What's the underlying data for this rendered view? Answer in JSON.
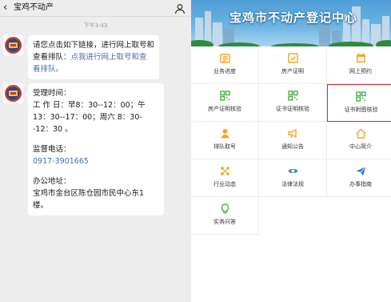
{
  "chat": {
    "title": "宝鸡不动产",
    "back_icon": "chevron-left-icon",
    "profile_icon": "person-icon",
    "timestamp": "下午3:43",
    "messages": [
      {
        "line1": "请您点击如下链接，进行网上取号和查看排队：",
        "link": "点我进行网上取号和查看排队。"
      },
      {
        "hours_label": "受理时间：",
        "hours_text": "工 作 日：早8：30--12：00；午13：30--17：00；周六 8：30--12：30 。",
        "phone_label": "监督电话：",
        "phone": "0917-3901665",
        "address_label": "办公地址：",
        "address": "宝鸡市金台区陈仓园市民中心东1楼。"
      }
    ]
  },
  "portal": {
    "banner_title": "宝鸡市不动产登记中心",
    "menu": [
      {
        "label": "业务进度",
        "icon": "progress-icon",
        "color": "#f5a623"
      },
      {
        "label": "房产证明",
        "icon": "certificate-icon",
        "color": "#f5a623"
      },
      {
        "label": "网上预约",
        "icon": "calendar-icon",
        "color": "#f5a623"
      },
      {
        "label": "房产证明核验",
        "icon": "qr-code-icon",
        "color": "#4cae4c"
      },
      {
        "label": "证书证明核验",
        "icon": "qr-code-icon",
        "color": "#4cae4c"
      },
      {
        "label": "证书附图核验",
        "icon": "qr-code-icon",
        "color": "#4cae4c"
      },
      {
        "label": "排队取号",
        "icon": "queue-person-icon",
        "color": "#f5a623"
      },
      {
        "label": "通知公告",
        "icon": "megaphone-icon",
        "color": "#f5a623"
      },
      {
        "label": "中心简介",
        "icon": "home-icon",
        "color": "#f5a623"
      },
      {
        "label": "行业动态",
        "icon": "dynamics-icon",
        "color": "#f5a623"
      },
      {
        "label": "法律法规",
        "icon": "eye-icon",
        "color": "#3a7bd5"
      },
      {
        "label": "办事指南",
        "icon": "send-icon",
        "color": "#3a7bd5"
      },
      {
        "label": "实务问答",
        "icon": "lightbulb-icon",
        "color": "#4cae4c"
      }
    ],
    "highlight_color": "#e0262e"
  }
}
